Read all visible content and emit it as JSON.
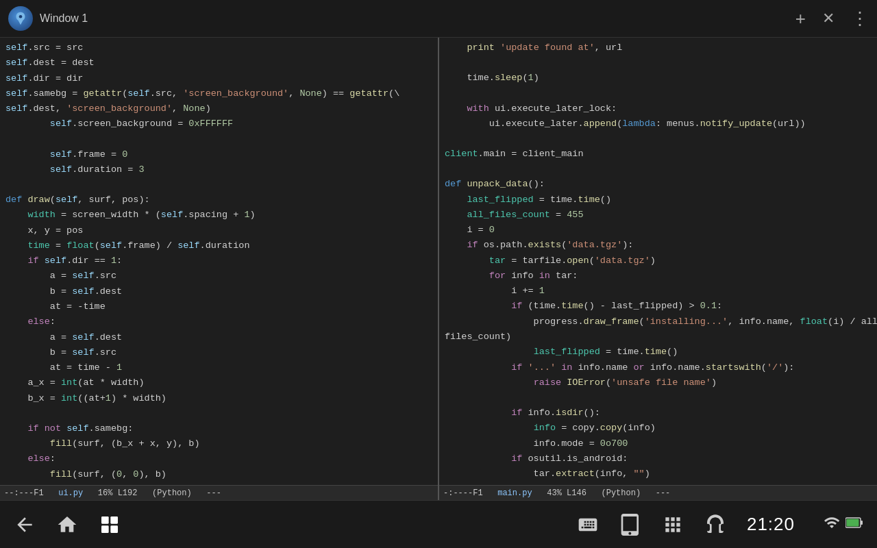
{
  "titlebar": {
    "title": "Window 1",
    "add_icon": "+",
    "close_icon": "✕",
    "menu_icon": "⋮"
  },
  "pane_left": {
    "filename": "ui.py",
    "percent": "16%",
    "line": "L192",
    "mode": "Python",
    "status_left": "--:---F1",
    "status_right": "16% L192   (Python)   --"
  },
  "pane_right": {
    "filename": "main.py",
    "percent": "43%",
    "line": "L146",
    "mode": "Python",
    "status_left": "-:----F1",
    "status_right": "43% L146   (Python)   --"
  },
  "taskbar": {
    "time": "21:20",
    "nav_icons": [
      "back",
      "home",
      "recent",
      "keyboard",
      "tablet",
      "grid",
      "headphones"
    ]
  }
}
